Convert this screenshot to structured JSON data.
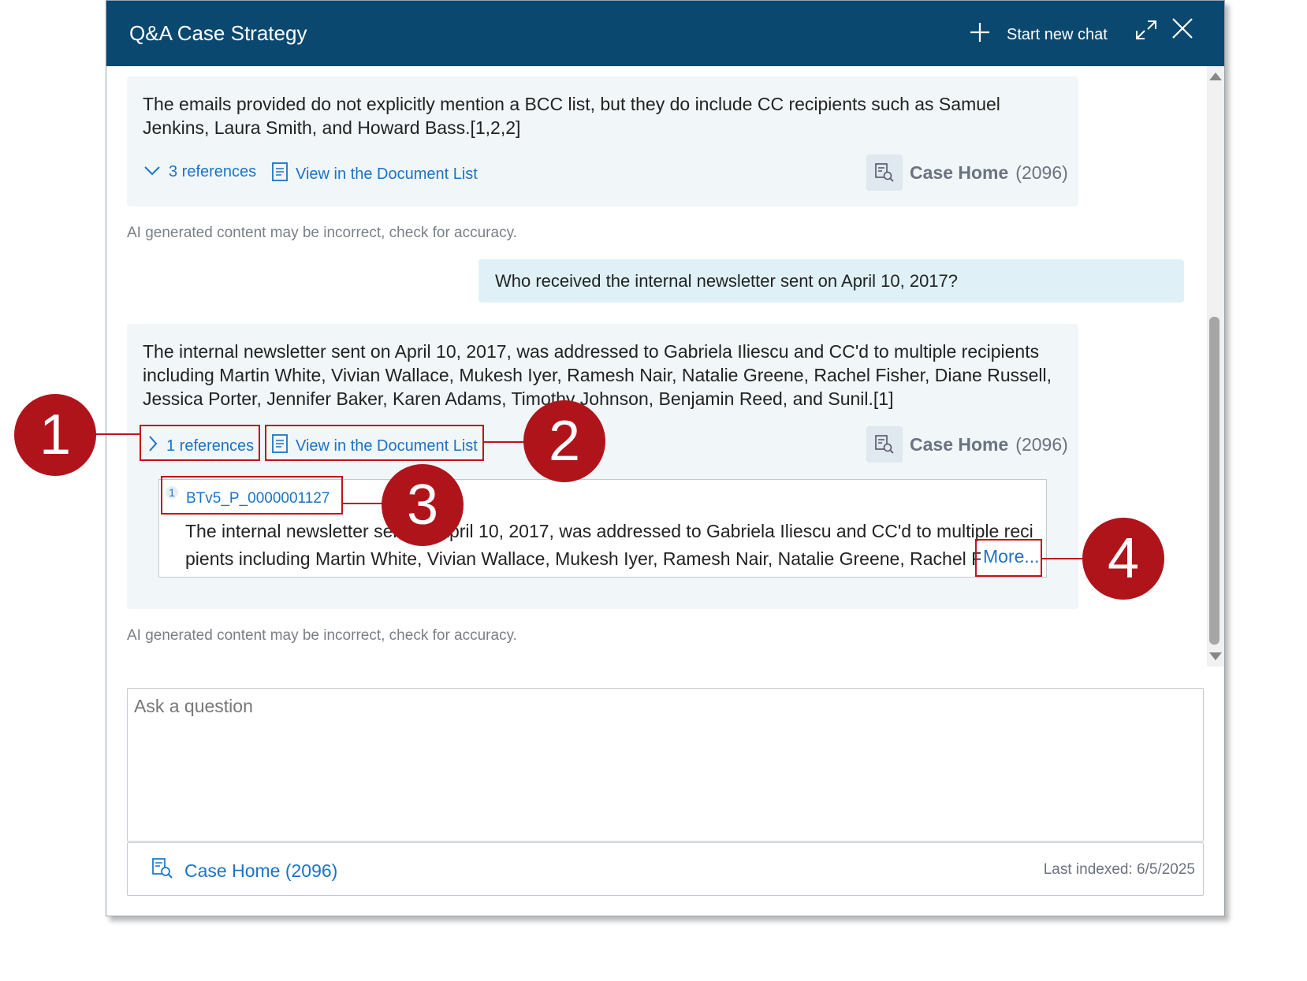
{
  "header": {
    "title": "Q&A Case Strategy",
    "new_chat_label": "Start new chat"
  },
  "messages": [
    {
      "role": "assistant",
      "text": "The emails provided do not explicitly mention a BCC list, but they do include CC recipients such as Samuel Jenkins, Laura Smith, and Howard Bass.[1,2,2]",
      "references_label": "3 references",
      "view_list_label": "View in the Document List",
      "case_name": "Case Home",
      "case_count": "(2096)",
      "disclaimer": "AI generated content may be incorrect, check for accuracy."
    },
    {
      "role": "user",
      "text": "Who received the internal newsletter sent on April 10, 2017?"
    },
    {
      "role": "assistant",
      "text": "The internal newsletter sent on April 10, 2017, was addressed to Gabriela Iliescu and CC'd to multiple recipients including Martin White, Vivian Wallace, Mukesh Iyer, Ramesh Nair, Natalie Greene, Rachel Fisher, Diane Russell, Jessica Porter, Jennifer Baker, Karen Adams, Timothy Johnson, Benjamin Reed, and Sunil.[1]",
      "references_label": "1 references",
      "view_list_label": "View in the Document List",
      "case_name": "Case Home",
      "case_count": "(2096)",
      "reference": {
        "number": "1",
        "doc_id": "BTv5_P_0000001127",
        "snippet": "The internal newsletter sent on April 10, 2017, was addressed to Gabriela Iliescu and CC'd to multiple reci pients including Martin White, Vivian Wallace, Mukesh Iyer, Ramesh Nair, Natalie Greene, Rachel F",
        "more_label": "More..."
      },
      "disclaimer": "AI generated content may be incorrect, check for accuracy."
    }
  ],
  "input": {
    "placeholder": "Ask a question"
  },
  "footer": {
    "case_label": "Case Home (2096)",
    "last_indexed": "Last indexed: 6/5/2025"
  },
  "annotations": [
    "1",
    "2",
    "3",
    "4"
  ],
  "colors": {
    "header_bg": "#0b4870",
    "link": "#1a73c8",
    "annotation": "#b0141b"
  }
}
